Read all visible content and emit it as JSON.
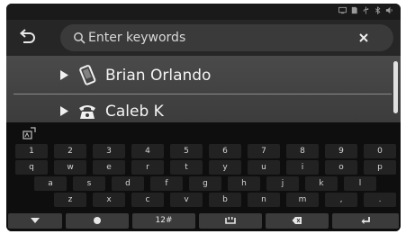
{
  "status_bar": {
    "icons": [
      "screen-icon",
      "sd-card-icon",
      "usb-icon",
      "bluetooth-icon",
      "volume-icon"
    ]
  },
  "header": {
    "back_icon": "back-arrow-icon",
    "search": {
      "placeholder": "Enter keywords",
      "value": ""
    },
    "clear_icon": "close-icon"
  },
  "contacts": [
    {
      "name": "Brian Orlando",
      "icon": "mobile-phone-icon"
    },
    {
      "name": "Caleb K",
      "icon": "home-phone-icon"
    }
  ],
  "keyboard": {
    "handwriting_icon": "handwriting-icon",
    "rows": [
      [
        "1",
        "2",
        "3",
        "4",
        "5",
        "6",
        "7",
        "8",
        "9",
        "0"
      ],
      [
        "q",
        "w",
        "e",
        "r",
        "t",
        "y",
        "u",
        "i",
        "o",
        "p"
      ],
      [
        "a",
        "s",
        "d",
        "f",
        "g",
        "h",
        "j",
        "k",
        "l"
      ],
      [
        "z",
        "x",
        "c",
        "v",
        "b",
        "n",
        "m",
        ",",
        "."
      ]
    ],
    "function_keys": [
      {
        "name": "hide-keyboard-key",
        "icon": "chevron-down-icon"
      },
      {
        "name": "language-key",
        "icon": "globe-icon"
      },
      {
        "name": "symbols-key",
        "label": "12#"
      },
      {
        "name": "space-key",
        "icon": "space-icon"
      },
      {
        "name": "backspace-key",
        "icon": "backspace-icon"
      },
      {
        "name": "enter-key",
        "icon": "enter-icon"
      }
    ]
  }
}
